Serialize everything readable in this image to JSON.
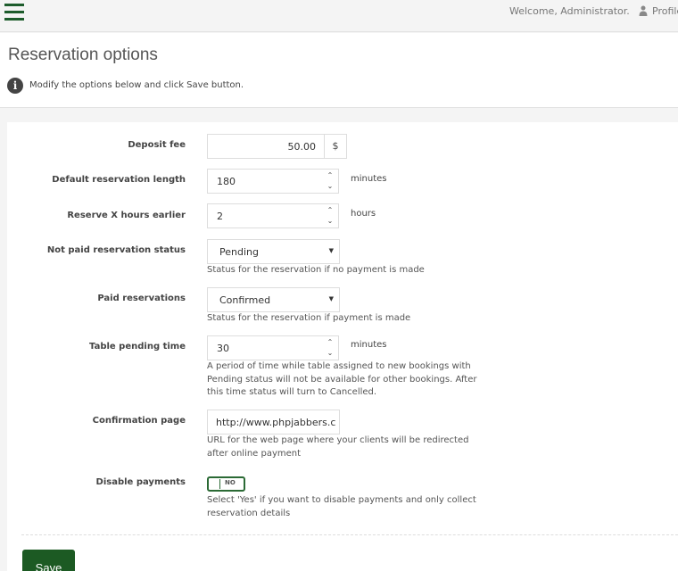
{
  "topbar": {
    "welcome": "Welcome, Administrator.",
    "profile_label": "Profile"
  },
  "header": {
    "title": "Reservation options",
    "intro": "Modify the options below and click Save button."
  },
  "form": {
    "deposit_fee": {
      "label": "Deposit fee",
      "value": "50.00",
      "currency": "$"
    },
    "default_length": {
      "label": "Default reservation length",
      "value": "180",
      "unit": "minutes"
    },
    "reserve_earlier": {
      "label": "Reserve X hours earlier",
      "value": "2",
      "unit": "hours"
    },
    "not_paid_status": {
      "label": "Not paid reservation status",
      "value": "Pending",
      "help": "Status for the reservation if no payment is made"
    },
    "paid_status": {
      "label": "Paid reservations",
      "value": "Confirmed",
      "help": "Status for the reservation if payment is made"
    },
    "pending_time": {
      "label": "Table pending time",
      "value": "30",
      "unit": "minutes",
      "help": "A period of time while table assigned to new bookings with Pending status will not be available for other bookings. After this time status will turn to Cancelled."
    },
    "confirmation_page": {
      "label": "Confirmation page",
      "value": "http://www.phpjabbers.c",
      "help": "URL for the web page where your clients will be redirected after online payment"
    },
    "disable_payments": {
      "label": "Disable payments",
      "toggle_text": "NO",
      "help": "Select 'Yes' if you want to disable payments and only collect reservation details"
    }
  },
  "actions": {
    "save_label": "Save"
  },
  "colors": {
    "accent": "#1c5a23",
    "toggle_border": "#2b6a35"
  }
}
